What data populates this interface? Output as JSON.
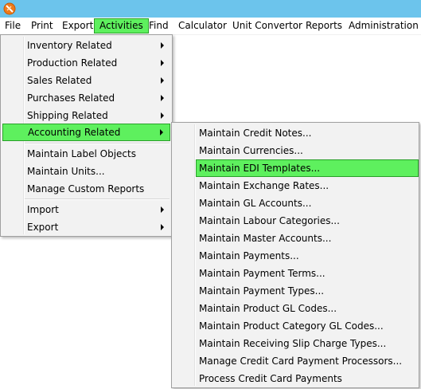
{
  "colors": {
    "titlebar": "#6cc4ec",
    "highlight": "#5ef05e",
    "highlight_border": "#2aa02a",
    "menu_bg": "#f2f2f2"
  },
  "titlebar": {
    "icon": "app-logo-icon"
  },
  "menubar": {
    "items": [
      "File",
      "Print",
      "Export",
      "Activities",
      "Find",
      "Calculator",
      "Unit Convertor",
      "Reports",
      "Administration"
    ],
    "active": "Activities"
  },
  "activities_menu": {
    "items": [
      {
        "label": "Inventory Related",
        "submenu": true
      },
      {
        "label": "Production Related",
        "submenu": true
      },
      {
        "label": "Sales Related",
        "submenu": true
      },
      {
        "label": "Purchases Related",
        "submenu": true
      },
      {
        "label": "Shipping Related",
        "submenu": true
      },
      {
        "label": "Accounting Related",
        "submenu": true,
        "highlighted": true
      },
      {
        "label": "Maintain Label Objects",
        "submenu": false
      },
      {
        "label": "Maintain Units...",
        "submenu": false
      },
      {
        "label": "Manage Custom Reports",
        "submenu": false
      },
      {
        "label": "Import",
        "submenu": true
      },
      {
        "label": "Export",
        "submenu": true
      }
    ]
  },
  "accounting_submenu": {
    "items": [
      "Maintain Credit Notes...",
      "Maintain Currencies...",
      "Maintain EDI Templates...",
      "Maintain Exchange Rates...",
      "Maintain GL Accounts...",
      "Maintain Labour Categories...",
      "Maintain Master Accounts...",
      "Maintain Payments...",
      "Maintain Payment Terms...",
      "Maintain Payment Types...",
      "Maintain Product GL Codes...",
      "Maintain Product Category GL Codes...",
      "Maintain Receiving Slip Charge Types...",
      "Manage Credit Card Payment Processors...",
      "Process Credit Card Payments"
    ],
    "highlighted": "Maintain EDI Templates..."
  }
}
